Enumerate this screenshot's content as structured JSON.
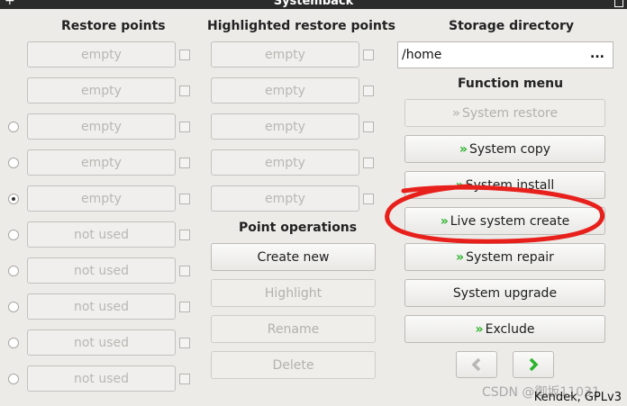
{
  "window": {
    "title": "Systemback",
    "plus": "+"
  },
  "headers": {
    "restore_points": "Restore points",
    "highlighted": "Highlighted restore points",
    "storage": "Storage directory",
    "function_menu": "Function menu",
    "point_operations": "Point operations"
  },
  "restore_points": [
    "empty",
    "empty",
    "empty",
    "empty",
    "empty",
    "not used",
    "not used",
    "not used",
    "not used",
    "not used"
  ],
  "highlighted_points": [
    "empty",
    "empty",
    "empty",
    "empty",
    "empty"
  ],
  "selected_radio_index": 2,
  "storage": {
    "path": "/home",
    "browse": "..."
  },
  "functions": [
    {
      "label": "System restore",
      "arrow": "»",
      "enabled": false
    },
    {
      "label": "System copy",
      "arrow": "»",
      "enabled": true
    },
    {
      "label": "System install",
      "arrow": "»",
      "enabled": true
    },
    {
      "label": "Live system create",
      "arrow": "»",
      "enabled": true
    },
    {
      "label": "System repair",
      "arrow": "»",
      "enabled": true
    },
    {
      "label": "System upgrade",
      "arrow": "",
      "enabled": true
    },
    {
      "label": "Exclude",
      "arrow": "»",
      "enabled": true
    }
  ],
  "operations": [
    {
      "label": "Create new",
      "enabled": true
    },
    {
      "label": "Highlight",
      "enabled": false
    },
    {
      "label": "Rename",
      "enabled": false
    },
    {
      "label": "Delete",
      "enabled": false
    }
  ],
  "nav": {
    "prev": "‹",
    "next": "›"
  },
  "footer": "Kendek, GPLv3",
  "watermark": "CSDN @御坂11031",
  "colors": {
    "accent_green": "#2bb32b",
    "annotation_red": "#e8201c"
  }
}
